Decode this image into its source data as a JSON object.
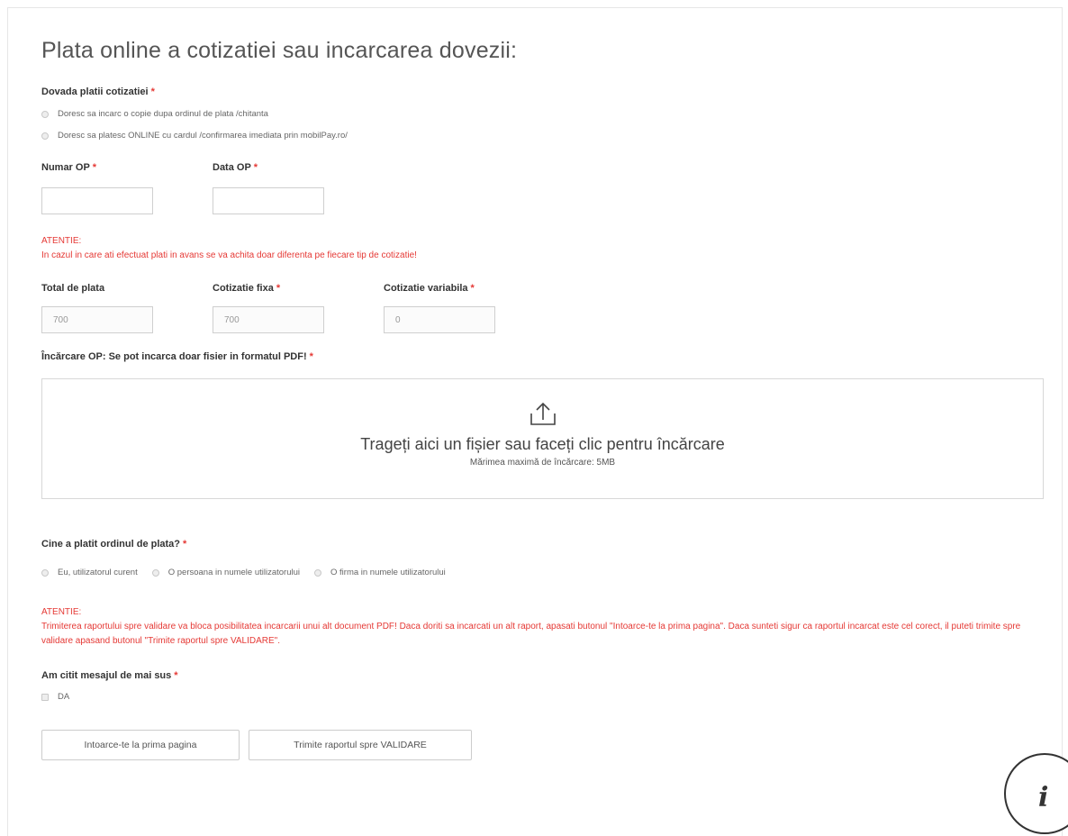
{
  "form": {
    "title": "Plata online a cotizatiei sau incarcarea dovezii:",
    "required_mark": "*",
    "proof": {
      "label": "Dovada platii cotizatiei",
      "options": [
        "Doresc sa incarc o copie dupa ordinul de plata /chitanta",
        "Doresc sa platesc ONLINE cu cardul /confirmarea imediata prin mobilPay.ro/"
      ]
    },
    "numar_op": {
      "label": "Numar OP",
      "value": ""
    },
    "data_op": {
      "label": "Data OP",
      "value": ""
    },
    "warning1": {
      "title": "ATENTIE:",
      "text": "In cazul in care ati efectuat plati in avans se va achita doar diferenta pe fiecare tip de cotizatie!"
    },
    "total": {
      "label": "Total de plata",
      "value": "700"
    },
    "cotizatie_fixa": {
      "label": "Cotizatie fixa",
      "value": "700"
    },
    "cotizatie_variabila": {
      "label": "Cotizatie variabila",
      "value": "0"
    },
    "upload": {
      "label": "Încărcare OP: Se pot incarca doar fisier in formatul PDF!",
      "drop_text": "Trageți aici un fișier sau faceți clic pentru încărcare",
      "max_size": "Mărimea maximă de încărcare: 5MB",
      "icon": "upload-icon"
    },
    "payer": {
      "label": "Cine a platit ordinul de plata?",
      "options": [
        "Eu, utilizatorul curent",
        "O persoana in numele utilizatorului",
        "O firma in numele utilizatorului"
      ]
    },
    "warning2": {
      "title": "ATENTIE:",
      "text": "Trimiterea raportului spre validare va bloca posibilitatea incarcarii unui alt document PDF! Daca doriti sa incarcati un alt raport, apasati butonul \"Intoarce-te la prima pagina\". Daca sunteti sigur ca raportul incarcat este cel corect, il puteti trimite spre validare apasand butonul \"Trimite raportul spre VALIDARE\"."
    },
    "confirm": {
      "label": "Am citit mesajul de mai sus",
      "option": "DA"
    },
    "buttons": {
      "back": "Intoarce-te la prima pagina",
      "submit": "Trimite raportul spre VALIDARE"
    }
  },
  "info_button": {
    "glyph": "i",
    "icon": "info-icon"
  },
  "colors": {
    "required": "#e53935",
    "warning": "#e53935"
  }
}
